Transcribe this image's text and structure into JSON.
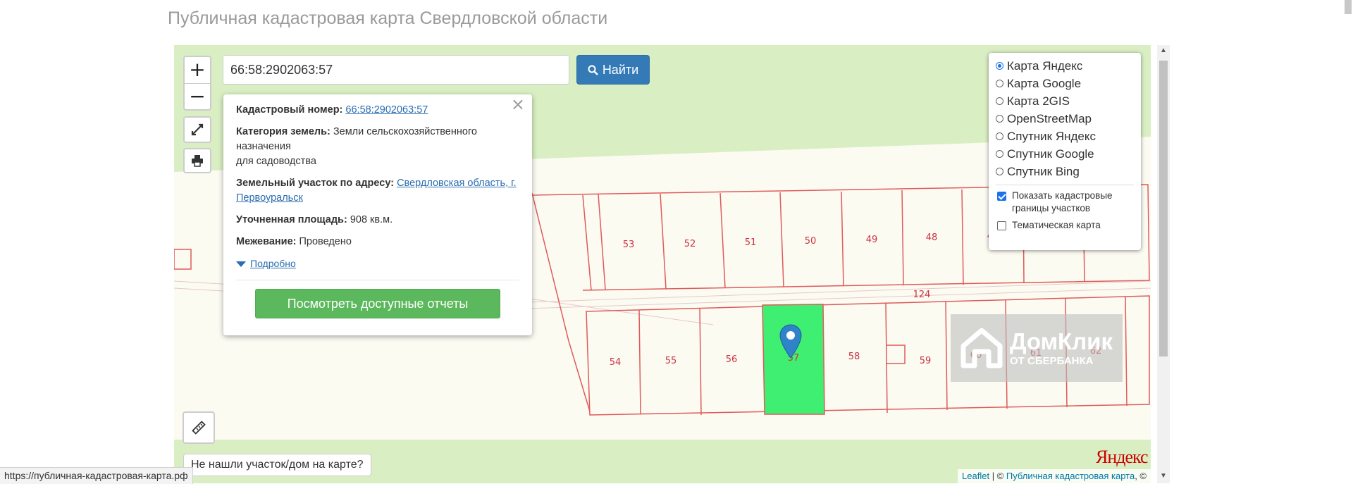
{
  "page": {
    "title": "Публичная кадастровая карта Свердловской области"
  },
  "search": {
    "value": "66:58:2902063:57",
    "button_label": "Найти"
  },
  "zoom": {
    "in_label": "+",
    "out_label": "−"
  },
  "popup": {
    "close_label": "×",
    "cadastral_label": "Кадастровый номер:",
    "cadastral_value": "66:58:2902063:57",
    "category_label": "Категория земель:",
    "category_value": "Земли сельскохозяйственного назначения",
    "category_use": "для садоводства",
    "address_label": "Земельный участок по адресу:",
    "address_value": "Свердловская область, г. Первоуральск",
    "area_label": "Уточненная площадь:",
    "area_value": "908 кв.м.",
    "survey_label": "Межевание:",
    "survey_value": "Проведено",
    "more_label": "Подробно",
    "reports_button": "Посмотреть доступные отчеты"
  },
  "layers": {
    "options": [
      {
        "label": "Карта Яндекс",
        "selected": true
      },
      {
        "label": "Карта Google",
        "selected": false
      },
      {
        "label": "Карта 2GIS",
        "selected": false
      },
      {
        "label": "OpenStreetMap",
        "selected": false
      },
      {
        "label": "Спутник Яндекс",
        "selected": false
      },
      {
        "label": "Спутник Google",
        "selected": false
      },
      {
        "label": "Спутник Bing",
        "selected": false
      }
    ],
    "show_borders_label": "Показать кадастровые границы участков",
    "show_borders_checked": true,
    "thematic_label": "Тематическая карта",
    "thematic_checked": false
  },
  "plots": {
    "upper": [
      "53",
      "52",
      "51",
      "50",
      "49",
      "48",
      "47"
    ],
    "lower": [
      "54",
      "55",
      "56",
      "57",
      "58",
      "59",
      "60",
      "61",
      "62"
    ],
    "road_label": "124",
    "highlighted": "57"
  },
  "not_found_label": "Не нашли участок/дом на карте?",
  "yandex_logo": "Яндекс",
  "attribution": {
    "leaflet": "Leaflet",
    "separator": " | © ",
    "site": "Публичная кадастровая карта",
    "tail": ", ©"
  },
  "watermark": {
    "main": "ДомКлик",
    "sub": "ОТ СБЕРБАНКА"
  },
  "status_url": "https://публичная-кадастровая-карта.рф",
  "colors": {
    "plot_border": "#e05a5a",
    "highlight": "#3fef72",
    "button_primary": "#337ab7",
    "button_success": "#5cb85c",
    "map_bg": "#d9efc3"
  }
}
